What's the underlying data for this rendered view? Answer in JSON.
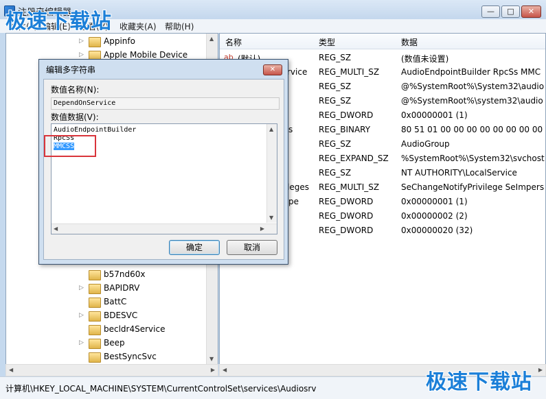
{
  "window": {
    "title": "注册表编辑器",
    "controls": {
      "minimize": "—",
      "maximize": "□",
      "close": "✕"
    }
  },
  "menu": {
    "file": "文件(F)",
    "edit": "编辑(E)",
    "view": "查看(V)",
    "favorites": "收藏夹(A)",
    "help": "帮助(H)"
  },
  "tree": {
    "items": [
      {
        "label": "Appinfo",
        "icon": "folder-icon"
      },
      {
        "label": "Apple Mobile Device",
        "icon": "folder-icon"
      },
      {
        "label": "b57nd60x",
        "icon": "folder-icon"
      },
      {
        "label": "BAPIDRV",
        "icon": "folder-icon"
      },
      {
        "label": "BattC",
        "icon": "folder-icon"
      },
      {
        "label": "BDESVC",
        "icon": "folder-icon"
      },
      {
        "label": "becldr4Service",
        "icon": "folder-icon"
      },
      {
        "label": "Beep",
        "icon": "folder-icon"
      },
      {
        "label": "BestSyncSvc",
        "icon": "folder-icon"
      }
    ]
  },
  "values": {
    "columns": {
      "name": "名称",
      "type": "类型",
      "data": "数据"
    },
    "rows": [
      {
        "name": "(默认)",
        "type": "REG_SZ",
        "data": "(数值未设置)"
      },
      {
        "name": "rvice",
        "type": "REG_MULTI_SZ",
        "data": "AudioEndpointBuilder RpcSs MMC"
      },
      {
        "name": "",
        "type": "REG_SZ",
        "data": "@%SystemRoot%\\System32\\audio"
      },
      {
        "name": "",
        "type": "REG_SZ",
        "data": "@%SystemRoot%\\system32\\audio"
      },
      {
        "name": "",
        "type": "REG_DWORD",
        "data": "0x00000001 (1)"
      },
      {
        "name": "s",
        "type": "REG_BINARY",
        "data": "80 51 01 00 00 00 00 00 00 00 00"
      },
      {
        "name": "",
        "type": "REG_SZ",
        "data": "AudioGroup"
      },
      {
        "name": "",
        "type": "REG_EXPAND_SZ",
        "data": "%SystemRoot%\\System32\\svchost."
      },
      {
        "name": "",
        "type": "REG_SZ",
        "data": "NT AUTHORITY\\LocalService"
      },
      {
        "name": "leges",
        "type": "REG_MULTI_SZ",
        "data": "SeChangeNotifyPrivilege SeImpers"
      },
      {
        "name": "pe",
        "type": "REG_DWORD",
        "data": "0x00000001 (1)"
      },
      {
        "name": "",
        "type": "REG_DWORD",
        "data": "0x00000002 (2)"
      },
      {
        "name": "",
        "type": "REG_DWORD",
        "data": "0x00000020 (32)"
      }
    ]
  },
  "dialog": {
    "title": "编辑多字符串",
    "name_label": "数值名称(N):",
    "name_value": "DependOnService",
    "data_label": "数值数据(V):",
    "data_lines": [
      "AudioEndpointBuilder",
      "RpcSs",
      "MMCSS"
    ],
    "ok": "确定",
    "cancel": "取消"
  },
  "status": {
    "path": "计算机\\HKEY_LOCAL_MACHINE\\SYSTEM\\CurrentControlSet\\services\\Audiosrv"
  },
  "watermark": {
    "text": "极速下载站"
  },
  "colors": {
    "accent": "#1b7fd8",
    "highlight_box": "#d9343a",
    "selection": "#3399ff"
  }
}
